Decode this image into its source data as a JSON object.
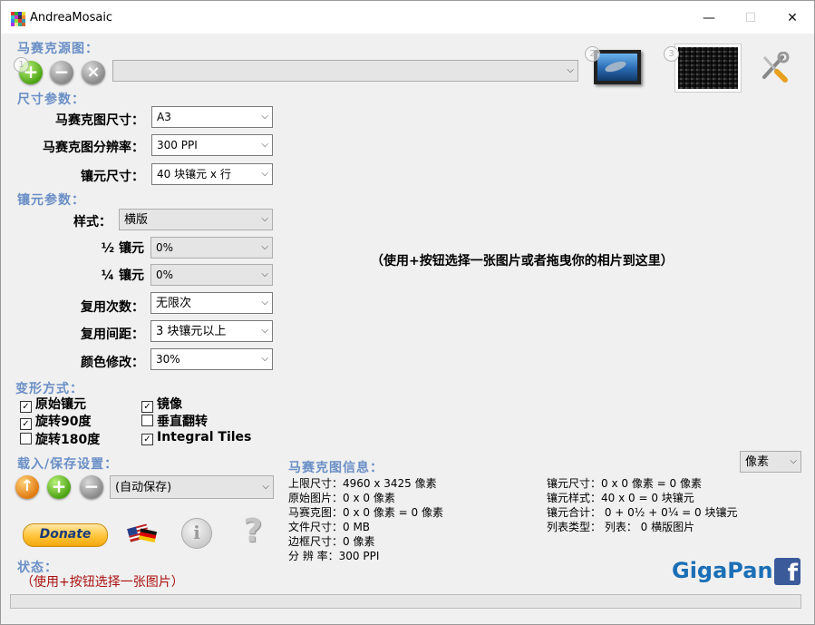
{
  "window": {
    "title": "AndreaMosaic",
    "minimize_glyph": "—",
    "maximize_glyph": "☐",
    "close_glyph": "✕"
  },
  "source": {
    "section_title": "马赛克源图：",
    "step1": "1",
    "add_icon": "+",
    "remove_icon": "−",
    "clear_icon": "×",
    "path_value": "",
    "step2": "2",
    "step3": "3"
  },
  "size_params": {
    "section_title": "尺寸参数：",
    "mosaic_size_label": "马赛克图尺寸：",
    "mosaic_size_value": "A3",
    "resolution_label": "马赛克图分辨率：",
    "resolution_value": "300 PPI",
    "tile_size_label": "镶元尺寸：",
    "tile_size_value": "40 块镶元 x 行"
  },
  "tile_params": {
    "section_title": "镶元参数：",
    "style_label": "样式：",
    "style_value": "横版",
    "half_label": "½ 镶元",
    "half_value": "0%",
    "quarter_label": "¼ 镶元",
    "quarter_value": "0%",
    "reuse_count_label": "复用次数：",
    "reuse_count_value": "无限次",
    "reuse_distance_label": "复用间距：",
    "reuse_distance_value": "3 块镶元以上",
    "color_label": "颜色修改：",
    "color_value": "30%"
  },
  "transform": {
    "section_title": "变形方式：",
    "items": [
      {
        "label": "原始镶元",
        "checked": true,
        "mark": "✓"
      },
      {
        "label": "镜像",
        "checked": true,
        "mark": "✓"
      },
      {
        "label": "旋转90度",
        "checked": true,
        "mark": "✓"
      },
      {
        "label": "垂直翻转",
        "checked": false,
        "mark": ""
      },
      {
        "label": "旋转180度",
        "checked": false,
        "mark": ""
      },
      {
        "label": "Integral Tiles",
        "checked": true,
        "mark": "✓"
      }
    ]
  },
  "load_save": {
    "section_title": "载入/保存设置：",
    "up_icon": "↑",
    "add_icon": "+",
    "remove_icon": "−",
    "select_value": "(自动保存)"
  },
  "tools": {
    "donate_label": "Donate",
    "info_glyph": "i",
    "help_glyph": "?"
  },
  "status": {
    "section_title": "状态：",
    "text": "（使用+按钮选择一张图片）"
  },
  "drop_hint": "（使用+按钮选择一张图片或者拖曳你的相片到这里）",
  "mosaic_info": {
    "section_title": "马赛克图信息：",
    "unit_value": "像素",
    "left_lines": [
      "上限尺寸：4960 x 3425 像素",
      "原始图片：0 x 0 像素",
      "马赛克图：0 x 0 像素 = 0 像素",
      "文件尺寸：0 MB",
      "边框尺寸：0 像素",
      "分 辨 率：300 PPI"
    ],
    "right_lines": [
      "镶元尺寸：0 x 0 像素 = 0 像素",
      "镶元样式：40 x 0 = 0 块镶元",
      "镶元合计： 0 + 0½ + 0¼ = 0 块镶元",
      "列表类型： 列表： 0 横版图片"
    ]
  },
  "footer": {
    "gigapan": "GigaPan",
    "facebook_glyph": "f"
  }
}
